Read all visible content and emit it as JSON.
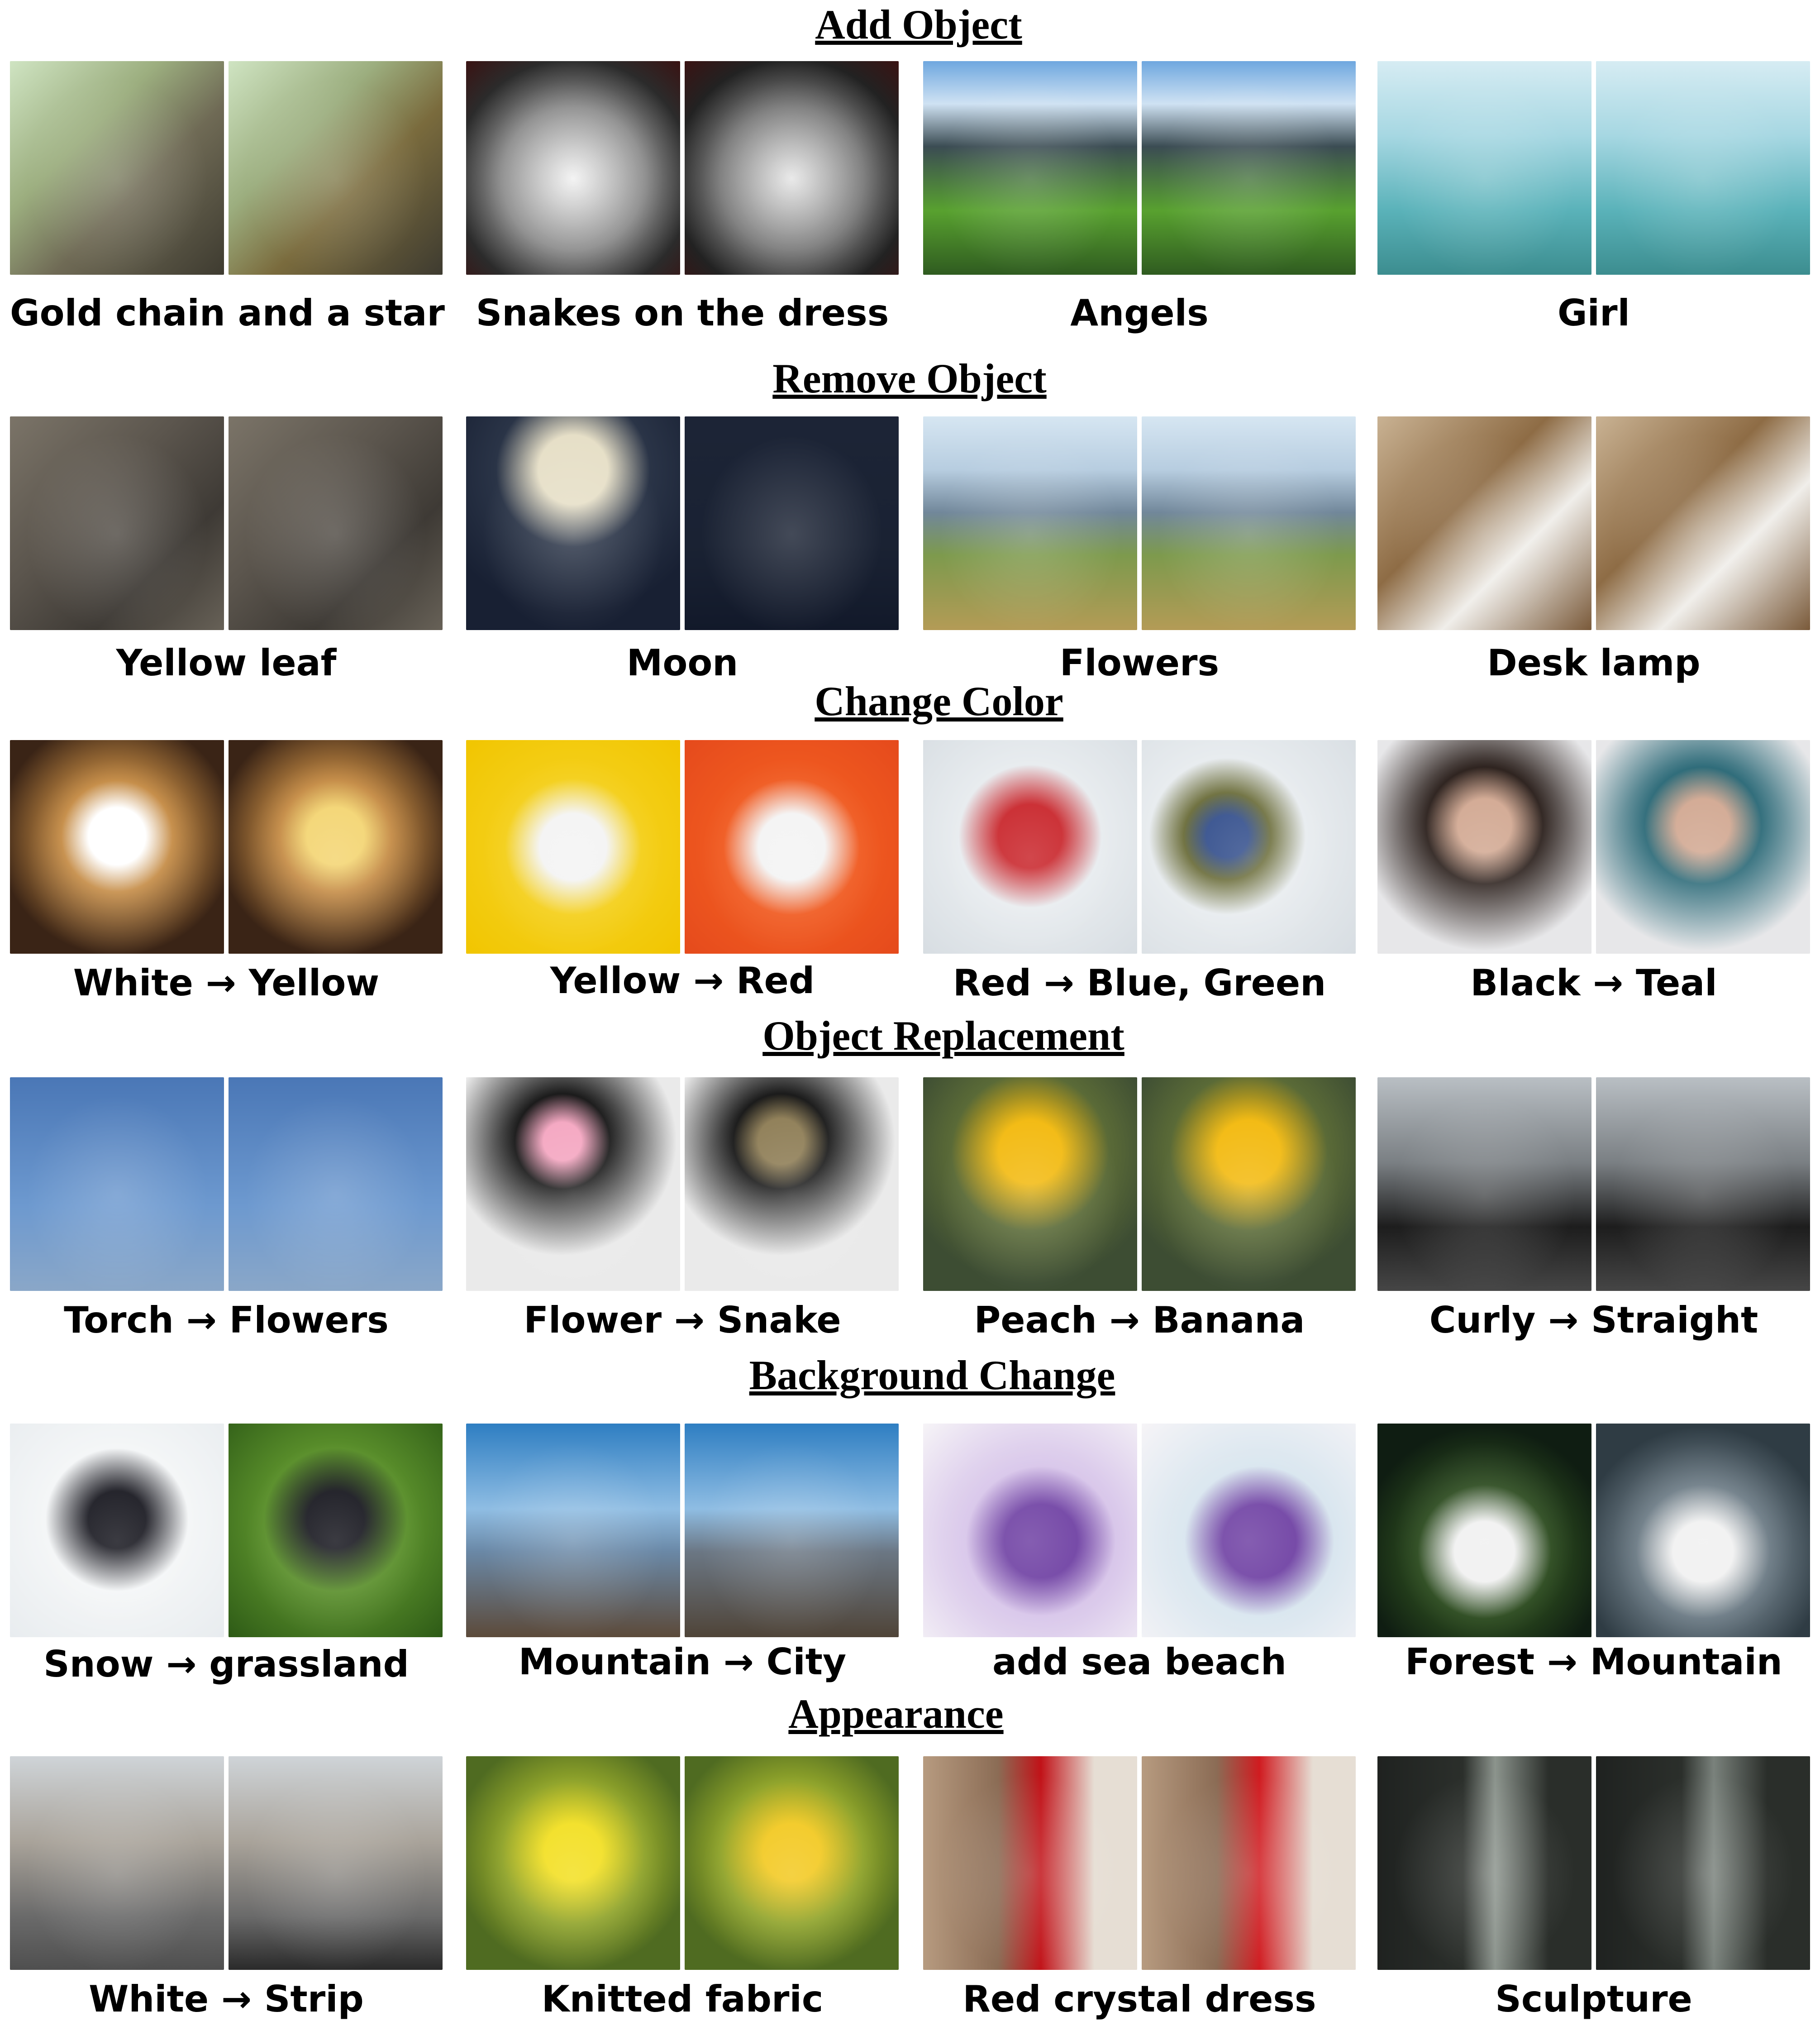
{
  "sections": [
    {
      "title": "Add Object",
      "captions": [
        "Gold chain and a star",
        "Snakes on the dress",
        "Angels",
        "Girl"
      ]
    },
    {
      "title": "Remove Object",
      "captions": [
        "Yellow leaf",
        "Moon",
        "Flowers",
        "Desk lamp"
      ]
    },
    {
      "title": "Change Color",
      "captions": [
        "White → Yellow",
        "Yellow → Red",
        "Red → Blue, Green",
        "Black → Teal"
      ]
    },
    {
      "title": "Object Replacement",
      "captions": [
        "Torch → Flowers",
        "Flower → Snake",
        "Peach → Banana",
        "Curly → Straight"
      ]
    },
    {
      "title": "Background Change",
      "captions": [
        "Snow → grassland",
        "Mountain → City",
        "add sea beach",
        "Forest → Mountain"
      ]
    },
    {
      "title": "Appearance",
      "captions": [
        "White → Strip",
        "Knitted fabric",
        "Red crystal dress",
        "Sculpture"
      ]
    }
  ]
}
